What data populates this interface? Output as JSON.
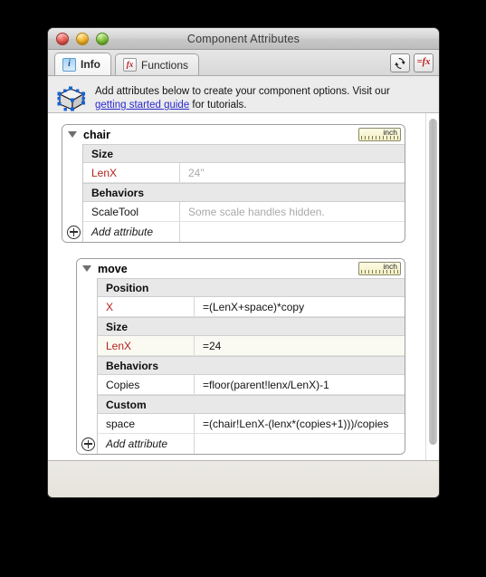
{
  "window": {
    "title": "Component Attributes",
    "controls": [
      "close-button",
      "minimize-button",
      "zoom-button"
    ]
  },
  "tabs": [
    {
      "label": "Info",
      "icon": "info-icon",
      "icon_glyph": "i",
      "active": true
    },
    {
      "label": "Functions",
      "icon": "fx-icon",
      "icon_glyph": "fx",
      "active": false
    }
  ],
  "toolbar": {
    "refresh_label": "⟳",
    "functions_label": "=fx"
  },
  "banner": {
    "icon": "component-cube-icon",
    "text_before": "Add attributes below to create your component options. Visit our",
    "link": "getting started guide",
    "text_after": "for tutorials."
  },
  "panels": [
    {
      "name": "chair",
      "unit": "inch",
      "expanded": true,
      "groups": [
        {
          "title": "Size",
          "attributes": [
            {
              "name": "LenX",
              "value": "24\"",
              "name_style": "red",
              "value_style": "muted",
              "row_style": "plain"
            }
          ]
        },
        {
          "title": "Behaviors",
          "attributes": [
            {
              "name": "ScaleTool",
              "value": "Some scale handles hidden.",
              "name_style": "plain",
              "value_style": "muted",
              "row_style": "plain"
            }
          ]
        }
      ],
      "add_attribute_label": "Add attribute"
    },
    {
      "name": "move",
      "unit": "inch",
      "expanded": true,
      "groups": [
        {
          "title": "Position",
          "attributes": [
            {
              "name": "X",
              "value": "=(LenX+space)*copy",
              "name_style": "red",
              "value_style": "plain",
              "row_style": "plain"
            }
          ]
        },
        {
          "title": "Size",
          "attributes": [
            {
              "name": "LenX",
              "value": "=24",
              "name_style": "red",
              "value_style": "plain",
              "row_style": "tint"
            }
          ]
        },
        {
          "title": "Behaviors",
          "attributes": [
            {
              "name": "Copies",
              "value": "=floor(parent!lenx/LenX)-1",
              "name_style": "plain",
              "value_style": "plain",
              "row_style": "plain"
            }
          ]
        },
        {
          "title": "Custom",
          "attributes": [
            {
              "name": "space",
              "value": "=(chair!LenX-(lenx*(copies+1)))/copies",
              "name_style": "plain",
              "value_style": "plain",
              "row_style": "plain"
            }
          ]
        }
      ],
      "add_attribute_label": "Add attribute"
    }
  ],
  "colors": {
    "attribute_red": "#b2221d",
    "link_blue": "#2a2ad0",
    "group_header_bg": "#e8e8e8",
    "highlight_row": "#fbfaf2",
    "window_bg": "#ececec"
  }
}
